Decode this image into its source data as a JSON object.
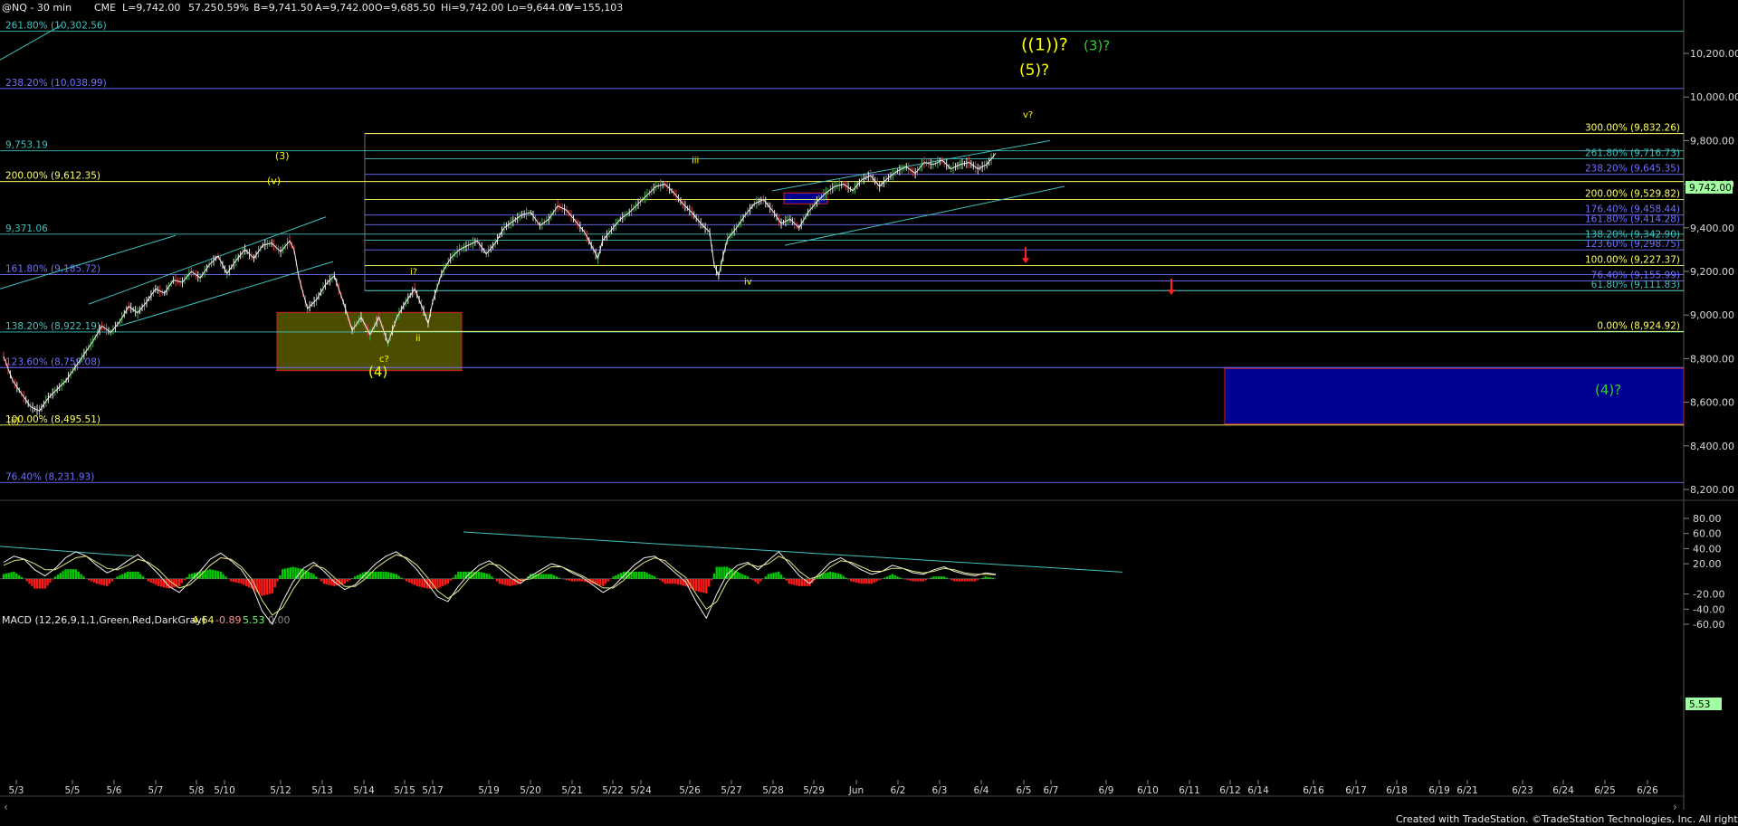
{
  "header": {
    "symbol": "@NQ - 30 min",
    "exchange": "CME",
    "last": "L=9,742.00",
    "change": "57.25",
    "pct": "0.59%",
    "bid": "B=9,741.50",
    "ask": "A=9,742.00",
    "open": "O=9,685.50",
    "high": "Hi=9,742.00",
    "low": "Lo=9,644.00",
    "volume": "V=155,103"
  },
  "macd_header": {
    "label": "MACD (12,26,9,1,1,Green,Red,DarkGray)",
    "v1": "4.64",
    "v2": "-0.89",
    "v3": "5.53",
    "v4": "0.00"
  },
  "footer": "Created with TradeStation. ©TradeStation Technologies, Inc. All rights reserved.",
  "colors": {
    "background": "#000000",
    "yellow": "#ffff00",
    "green_label": "#33cc33",
    "blue_line": "#7070ff",
    "cyan_line": "#40c0c0",
    "macd_pos": "#00cc00",
    "macd_neg": "#ff1a1a",
    "zone_blue": "#000090",
    "zone_olive": "#5a5a00",
    "last_price_box": "#a0ffa0"
  },
  "chart_data": [
    {
      "type": "line",
      "title": "@NQ - 30 min",
      "ylim": [
        8100,
        10400
      ],
      "y_ticks": [
        "10,200.00",
        "10,000.00",
        "9,800.00",
        "9,600.00",
        "9,400.00",
        "9,200.00",
        "9,000.00",
        "8,800.00",
        "8,600.00",
        "8,400.00",
        "8,200.00"
      ],
      "x_ticks": [
        "5/3",
        "5/5",
        "5/6",
        "5/7",
        "5/8",
        "5/10",
        "5/12",
        "5/13",
        "5/14",
        "5/15",
        "5/17",
        "5/19",
        "5/20",
        "5/21",
        "5/22",
        "5/24",
        "5/26",
        "5/27",
        "5/28",
        "5/29",
        "Jun",
        "6/2",
        "6/3",
        "6/4",
        "6/5",
        "6/7",
        "6/9",
        "6/10",
        "6/11",
        "6/12",
        "6/14",
        "6/16",
        "6/17",
        "6/18",
        "6/19",
        "6/21",
        "6/23",
        "6/24",
        "6/25",
        "6/26"
      ],
      "last_price": "9,742.00",
      "price_path": [
        [
          0,
          8810
        ],
        [
          2,
          8700
        ],
        [
          4,
          8640
        ],
        [
          6,
          8580
        ],
        [
          8,
          8560
        ],
        [
          10,
          8620
        ],
        [
          12,
          8660
        ],
        [
          14,
          8700
        ],
        [
          16,
          8760
        ],
        [
          18,
          8820
        ],
        [
          20,
          8880
        ],
        [
          22,
          8950
        ],
        [
          24,
          8920
        ],
        [
          26,
          8970
        ],
        [
          28,
          9040
        ],
        [
          30,
          9010
        ],
        [
          32,
          9060
        ],
        [
          34,
          9120
        ],
        [
          36,
          9100
        ],
        [
          38,
          9160
        ],
        [
          40,
          9150
        ],
        [
          42,
          9200
        ],
        [
          44,
          9170
        ],
        [
          46,
          9230
        ],
        [
          48,
          9270
        ],
        [
          50,
          9190
        ],
        [
          52,
          9250
        ],
        [
          54,
          9300
        ],
        [
          56,
          9260
        ],
        [
          58,
          9320
        ],
        [
          60,
          9330
        ],
        [
          62,
          9290
        ],
        [
          64,
          9340
        ],
        [
          65,
          9300
        ],
        [
          66,
          9180
        ],
        [
          67,
          9100
        ],
        [
          68,
          9030
        ],
        [
          70,
          9070
        ],
        [
          72,
          9140
        ],
        [
          74,
          9180
        ],
        [
          76,
          9060
        ],
        [
          78,
          8930
        ],
        [
          80,
          8990
        ],
        [
          82,
          8910
        ],
        [
          84,
          8990
        ],
        [
          86,
          8870
        ],
        [
          88,
          8990
        ],
        [
          90,
          9060
        ],
        [
          92,
          9120
        ],
        [
          94,
          9020
        ],
        [
          95,
          8960
        ],
        [
          96,
          9060
        ],
        [
          98,
          9190
        ],
        [
          100,
          9260
        ],
        [
          102,
          9300
        ],
        [
          104,
          9320
        ],
        [
          106,
          9340
        ],
        [
          108,
          9280
        ],
        [
          110,
          9330
        ],
        [
          112,
          9400
        ],
        [
          114,
          9430
        ],
        [
          116,
          9460
        ],
        [
          118,
          9470
        ],
        [
          120,
          9410
        ],
        [
          122,
          9440
        ],
        [
          124,
          9500
        ],
        [
          126,
          9480
        ],
        [
          128,
          9430
        ],
        [
          130,
          9380
        ],
        [
          132,
          9300
        ],
        [
          133,
          9260
        ],
        [
          134,
          9340
        ],
        [
          136,
          9390
        ],
        [
          138,
          9440
        ],
        [
          140,
          9470
        ],
        [
          142,
          9510
        ],
        [
          144,
          9550
        ],
        [
          146,
          9590
        ],
        [
          148,
          9600
        ],
        [
          150,
          9560
        ],
        [
          152,
          9510
        ],
        [
          154,
          9470
        ],
        [
          156,
          9420
        ],
        [
          158,
          9380
        ],
        [
          159,
          9230
        ],
        [
          160,
          9180
        ],
        [
          161,
          9270
        ],
        [
          162,
          9350
        ],
        [
          164,
          9400
        ],
        [
          166,
          9460
        ],
        [
          168,
          9510
        ],
        [
          170,
          9530
        ],
        [
          172,
          9480
        ],
        [
          174,
          9420
        ],
        [
          176,
          9440
        ],
        [
          178,
          9400
        ],
        [
          180,
          9470
        ],
        [
          182,
          9520
        ],
        [
          184,
          9560
        ],
        [
          186,
          9590
        ],
        [
          188,
          9600
        ],
        [
          190,
          9570
        ],
        [
          192,
          9620
        ],
        [
          194,
          9640
        ],
        [
          196,
          9590
        ],
        [
          198,
          9630
        ],
        [
          200,
          9660
        ],
        [
          202,
          9680
        ],
        [
          204,
          9650
        ],
        [
          206,
          9700
        ],
        [
          208,
          9690
        ],
        [
          210,
          9710
        ],
        [
          212,
          9670
        ],
        [
          214,
          9690
        ],
        [
          216,
          9700
        ],
        [
          218,
          9670
        ],
        [
          220,
          9690
        ],
        [
          222,
          9742
        ]
      ],
      "horizontal_levels": [
        {
          "label": "261.80% (10,302.56)",
          "value": 10302.56,
          "color": "#40c0c0"
        },
        {
          "label": "238.20% (10,038.99)",
          "value": 10038.99,
          "color": "#7070ff"
        },
        {
          "label": "9,753.19",
          "value": 9753.19,
          "color": "#40c0c0"
        },
        {
          "label": "200.00% (9,612.35)",
          "value": 9612.35,
          "color": "#ffff66"
        },
        {
          "label": "9,371.06",
          "value": 9371.06,
          "color": "#40c0c0"
        },
        {
          "label": "161.80% (9,185.72)",
          "value": 9185.72,
          "color": "#7070ff"
        },
        {
          "label": "138.20% (8,922.19)",
          "value": 8922.19,
          "color": "#40c0c0"
        },
        {
          "label": "123.60% (8,759.08)",
          "value": 8759.08,
          "color": "#7070ff"
        },
        {
          "label": "100.00% (8,495.51)",
          "value": 8495.51,
          "color": "#ffff66"
        },
        {
          "label": "76.40% (8,231.93)",
          "value": 8231.93,
          "color": "#7070ff"
        }
      ],
      "right_levels": [
        {
          "label": "300.00% (9,832.26)",
          "value": 9832.26,
          "color": "#ffff66"
        },
        {
          "label": "261.80% (9,716.73)",
          "value": 9716.73,
          "color": "#40c0c0"
        },
        {
          "label": "238.20% (9,645.35)",
          "value": 9645.35,
          "color": "#7070ff"
        },
        {
          "label": "200.00% (9,529.82)",
          "value": 9529.82,
          "color": "#ffff66"
        },
        {
          "label": "176.40% (9,458.44)",
          "value": 9458.44,
          "color": "#7070ff"
        },
        {
          "label": "161.80% (9,414.28)",
          "value": 9414.28,
          "color": "#7070ff"
        },
        {
          "label": "138.20% (9,342.90)",
          "value": 9342.9,
          "color": "#40c0c0"
        },
        {
          "label": "123.60% (9,298.75)",
          "value": 9298.75,
          "color": "#7070ff"
        },
        {
          "label": "100.00% (9,227.37)",
          "value": 9227.37,
          "color": "#ffff66"
        },
        {
          "label": "76.40% (9,155.99)",
          "value": 9155.99,
          "color": "#7070ff"
        },
        {
          "label": "61.80% (9,111.83)",
          "value": 9111.83,
          "color": "#40c0c0"
        },
        {
          "label": "0.00% (8,924.92)",
          "value": 8924.92,
          "color": "#ffff66"
        }
      ],
      "wave_labels": [
        {
          "text": "((1))?",
          "color": "#ffff00",
          "size": 19
        },
        {
          "text": "(3)?",
          "color": "#33cc33",
          "size": 15
        },
        {
          "text": "(5)?",
          "color": "#ffff00",
          "size": 17
        },
        {
          "text": "v?",
          "color": "#ffff00",
          "size": 10
        },
        {
          "text": "iii",
          "color": "#ffff00",
          "size": 10
        },
        {
          "text": "(3)",
          "color": "#ffff00",
          "size": 11
        },
        {
          "text": "(v)",
          "color": "#ffff00",
          "size": 11
        },
        {
          "text": "i?",
          "color": "#ffff00",
          "size": 10
        },
        {
          "text": "ii",
          "color": "#ffff00",
          "size": 10
        },
        {
          "text": "iv",
          "color": "#ffff00",
          "size": 10
        },
        {
          "text": "c?",
          "color": "#ffff00",
          "size": 10
        },
        {
          "text": "(4)",
          "color": "#ffff00",
          "size": 15
        },
        {
          "text": "(4)?",
          "color": "#33cc33",
          "size": 15
        },
        {
          "text": "(ii)",
          "color": "#ffff00",
          "size": 10
        }
      ]
    },
    {
      "type": "line",
      "title": "MACD (12,26,9,1,1,Green,Red,DarkGray)",
      "ylim": [
        -70,
        90
      ],
      "y_ticks": [
        "80.00",
        "60.00",
        "40.00",
        "20.00",
        "-20.00",
        "-40.00",
        "-60.00"
      ],
      "last_value": "5.53",
      "series": [
        {
          "name": "MACD",
          "values": [
            22,
            30,
            26,
            12,
            4,
            14,
            28,
            36,
            30,
            18,
            8,
            14,
            24,
            32,
            20,
            6,
            -10,
            -18,
            -4,
            10,
            26,
            34,
            24,
            12,
            -8,
            -42,
            -60,
            -30,
            -4,
            14,
            22,
            10,
            -4,
            -14,
            -8,
            6,
            20,
            30,
            36,
            26,
            12,
            -6,
            -24,
            -30,
            -10,
            6,
            18,
            24,
            14,
            2,
            -6,
            4,
            12,
            20,
            16,
            8,
            2,
            -8,
            -18,
            -10,
            4,
            18,
            28,
            30,
            20,
            8,
            -4,
            -30,
            -52,
            -20,
            6,
            18,
            22,
            12,
            24,
            36,
            20,
            4,
            -6,
            8,
            22,
            28,
            20,
            12,
            6,
            10,
            18,
            14,
            8,
            6,
            12,
            16,
            10,
            6,
            4,
            8,
            6
          ]
        },
        {
          "name": "Signal",
          "values": [
            18,
            24,
            26,
            20,
            12,
            12,
            20,
            28,
            30,
            22,
            14,
            12,
            18,
            26,
            22,
            12,
            -2,
            -12,
            -8,
            4,
            18,
            28,
            26,
            16,
            0,
            -28,
            -48,
            -38,
            -14,
            6,
            18,
            14,
            2,
            -10,
            -10,
            0,
            14,
            24,
            32,
            28,
            18,
            2,
            -16,
            -26,
            -16,
            0,
            12,
            20,
            18,
            8,
            -2,
            0,
            8,
            16,
            16,
            10,
            4,
            -4,
            -12,
            -12,
            -2,
            12,
            22,
            28,
            24,
            12,
            2,
            -20,
            -40,
            -30,
            -4,
            12,
            20,
            16,
            20,
            30,
            24,
            10,
            0,
            4,
            16,
            24,
            22,
            16,
            10,
            10,
            14,
            14,
            10,
            8,
            10,
            14,
            12,
            8,
            6,
            6,
            5.5
          ]
        }
      ]
    }
  ]
}
